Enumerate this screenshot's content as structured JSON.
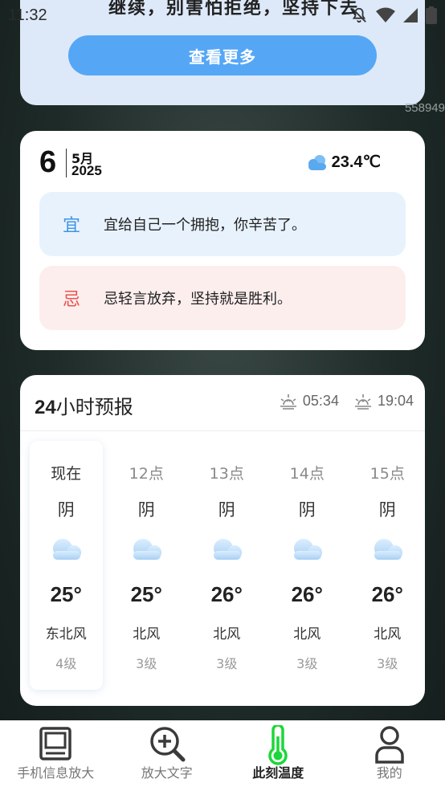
{
  "status": {
    "time": "11:32",
    "icons": [
      "mute-icon",
      "wifi-icon",
      "signal-icon",
      "battery-icon"
    ]
  },
  "top_card": {
    "cut_text": "继续，别害怕拒绝，坚持下去",
    "more_button": "查看更多",
    "watermark": "558949"
  },
  "almanac": {
    "day": "6",
    "month": "5月",
    "year": "2025",
    "weather_icon": "cloud-icon",
    "temperature": "23.4℃",
    "yi": {
      "tag": "宜",
      "text": "宜给自己一个拥抱，你辛苦了。"
    },
    "ji": {
      "tag": "忌",
      "text": "忌轻言放弃，坚持就是胜利。"
    }
  },
  "forecast": {
    "title_num": "24",
    "title_text": "小时预报",
    "sunrise": "05:34",
    "sunset": "19:04",
    "hours": [
      {
        "time": "现在",
        "cond": "阴",
        "temp": "25°",
        "wind": "东北风",
        "level": "4级"
      },
      {
        "time": "12点",
        "cond": "阴",
        "temp": "25°",
        "wind": "北风",
        "level": "3级"
      },
      {
        "time": "13点",
        "cond": "阴",
        "temp": "26°",
        "wind": "北风",
        "level": "3级"
      },
      {
        "time": "14点",
        "cond": "阴",
        "temp": "26°",
        "wind": "北风",
        "level": "3级"
      },
      {
        "time": "15点",
        "cond": "阴",
        "temp": "26°",
        "wind": "北风",
        "level": "3级"
      }
    ]
  },
  "nav": {
    "items": [
      {
        "label": "手机信息放大",
        "icon": "monitor-icon"
      },
      {
        "label": "放大文字",
        "icon": "zoom-in-icon"
      },
      {
        "label": "此刻温度",
        "icon": "thermometer-icon"
      },
      {
        "label": "我的",
        "icon": "user-icon"
      }
    ],
    "active_color": "#1bd73a"
  }
}
